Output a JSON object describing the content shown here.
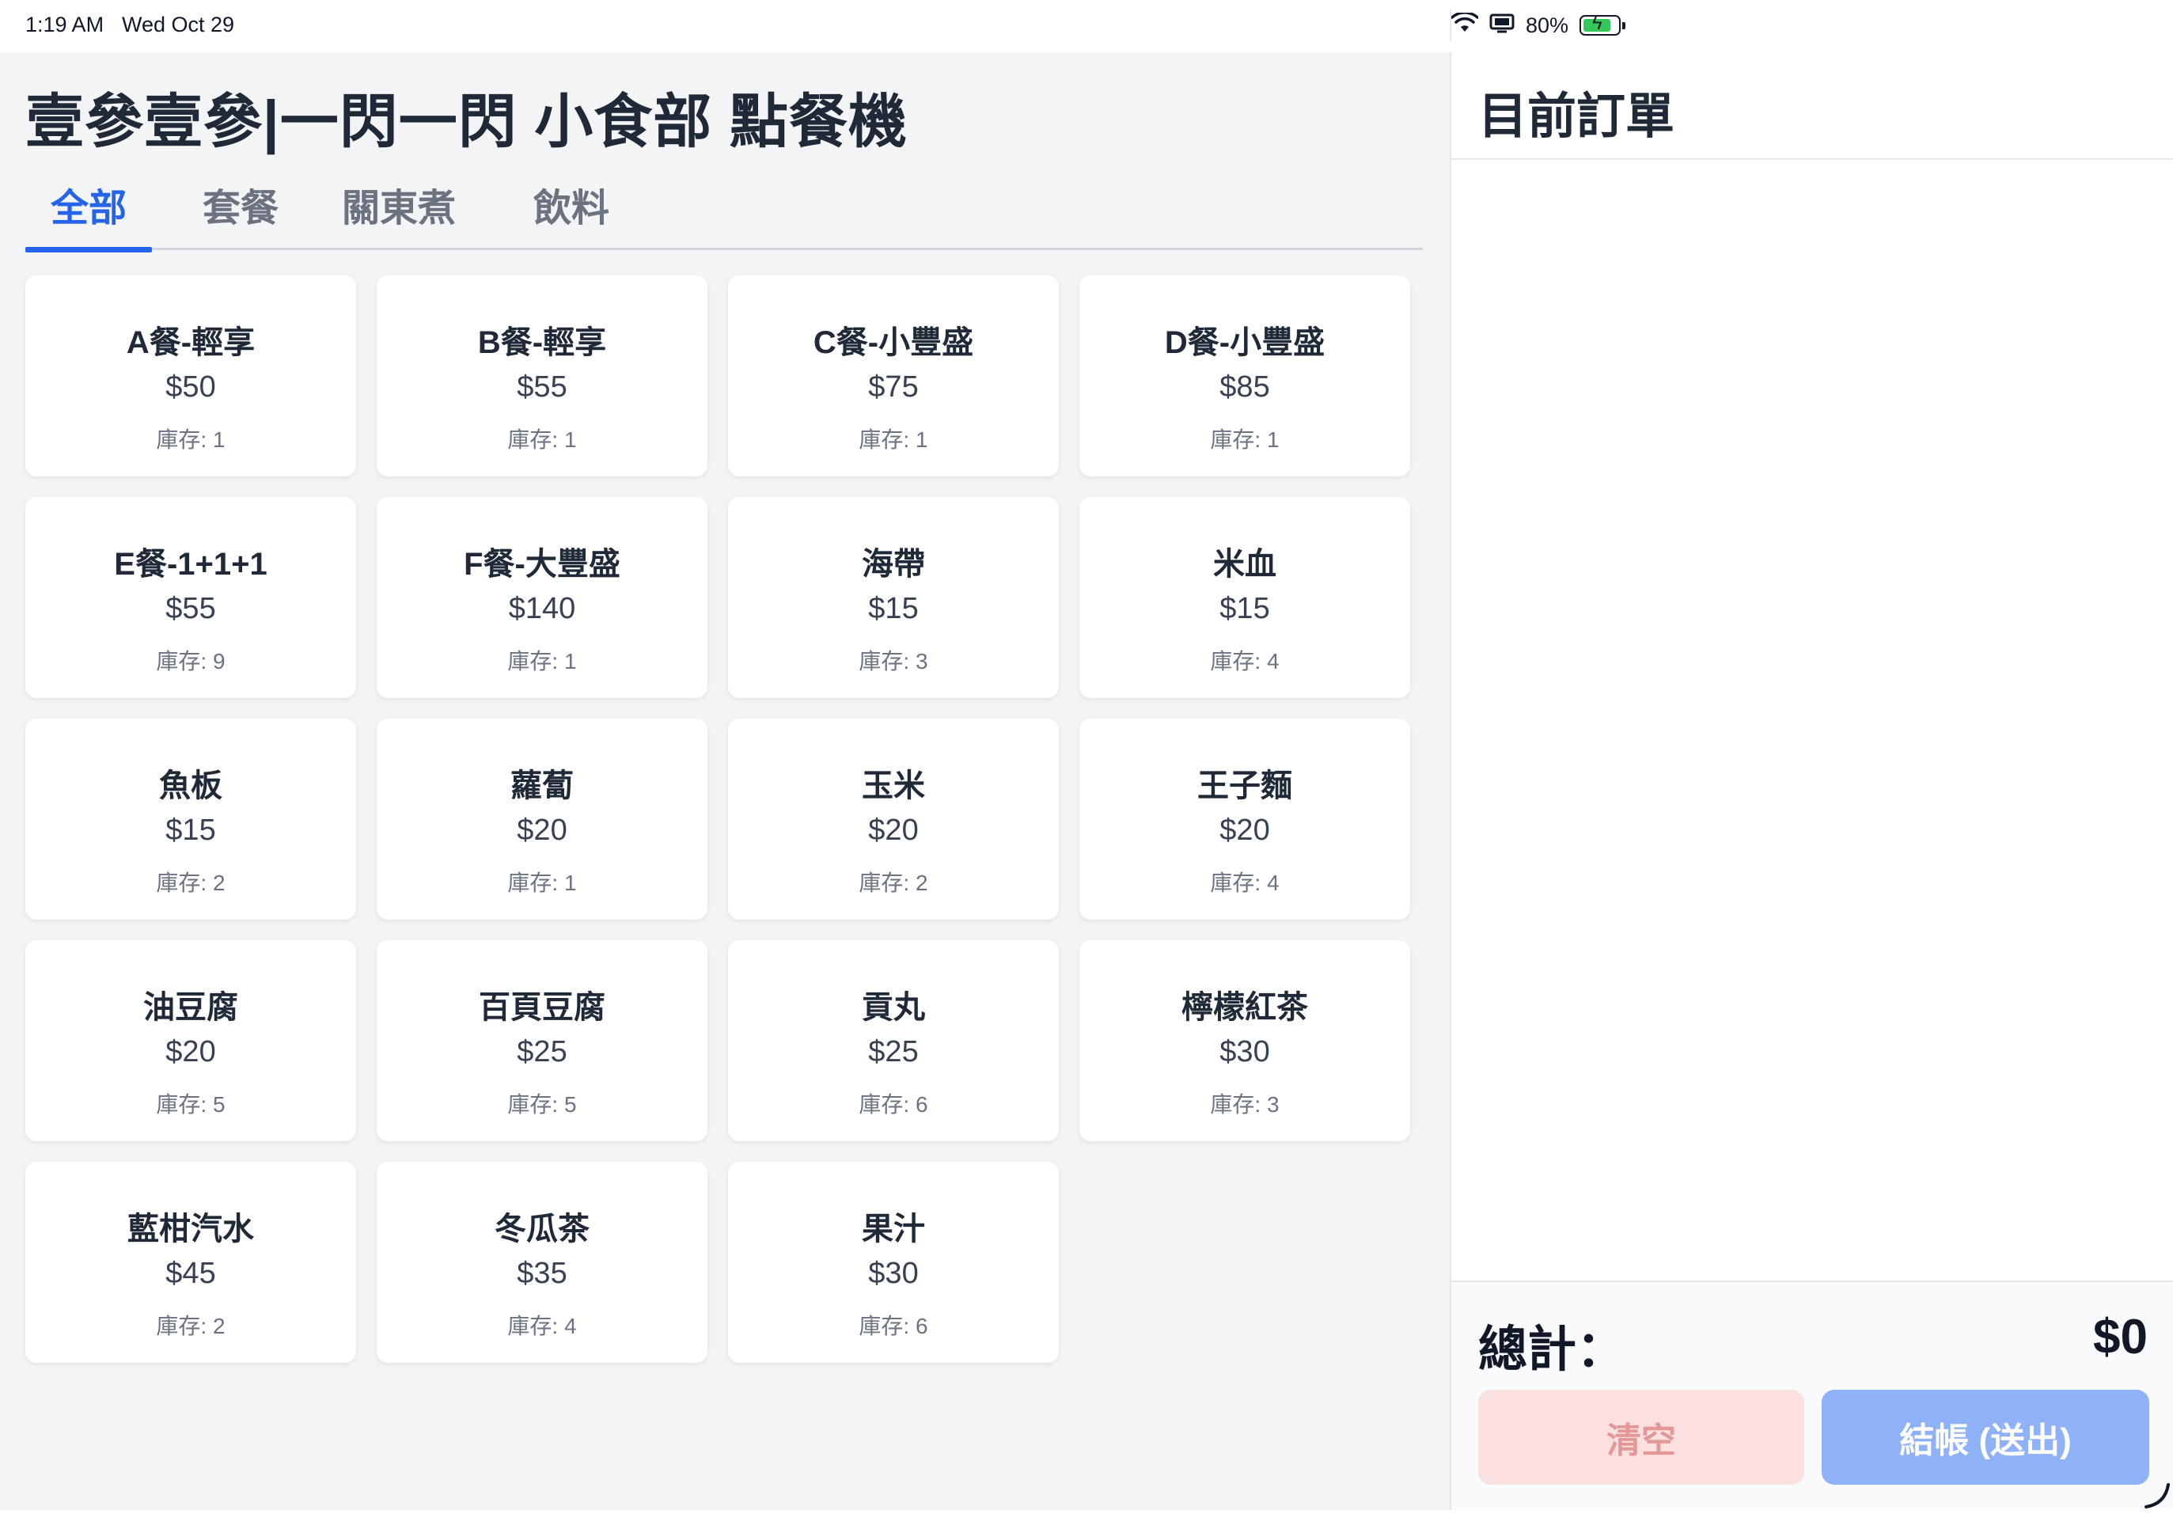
{
  "status_bar": {
    "time": "1:19 AM",
    "date": "Wed Oct 29",
    "battery_percent": "80%",
    "battery_level": 0.8,
    "icons": [
      "wifi-icon",
      "screen-mirroring-icon",
      "battery-charging-icon"
    ]
  },
  "app": {
    "title": "壹參壹參|一閃一閃 小食部 點餐機"
  },
  "tabs": [
    {
      "label": "全部",
      "active": true
    },
    {
      "label": "套餐",
      "active": false
    },
    {
      "label": "關東煮",
      "active": false
    },
    {
      "label": "飲料",
      "active": false
    }
  ],
  "stock_prefix": "庫存: ",
  "menu": [
    {
      "name": "A餐-輕享",
      "price": "$50",
      "stock": "庫存: 1"
    },
    {
      "name": "B餐-輕享",
      "price": "$55",
      "stock": "庫存: 1"
    },
    {
      "name": "C餐-小豐盛",
      "price": "$75",
      "stock": "庫存: 1"
    },
    {
      "name": "D餐-小豐盛",
      "price": "$85",
      "stock": "庫存: 1"
    },
    {
      "name": "E餐-1+1+1",
      "price": "$55",
      "stock": "庫存: 9"
    },
    {
      "name": "F餐-大豐盛",
      "price": "$140",
      "stock": "庫存: 1"
    },
    {
      "name": "海帶",
      "price": "$15",
      "stock": "庫存: 3"
    },
    {
      "name": "米血",
      "price": "$15",
      "stock": "庫存: 4"
    },
    {
      "name": "魚板",
      "price": "$15",
      "stock": "庫存: 2"
    },
    {
      "name": "蘿蔔",
      "price": "$20",
      "stock": "庫存: 1"
    },
    {
      "name": "玉米",
      "price": "$20",
      "stock": "庫存: 2"
    },
    {
      "name": "王子麵",
      "price": "$20",
      "stock": "庫存: 4"
    },
    {
      "name": "油豆腐",
      "price": "$20",
      "stock": "庫存: 5"
    },
    {
      "name": "百頁豆腐",
      "price": "$25",
      "stock": "庫存: 5"
    },
    {
      "name": "貢丸",
      "price": "$25",
      "stock": "庫存: 6"
    },
    {
      "name": "檸檬紅茶",
      "price": "$30",
      "stock": "庫存: 3"
    },
    {
      "name": "藍柑汽水",
      "price": "$45",
      "stock": "庫存: 2"
    },
    {
      "name": "冬瓜茶",
      "price": "$35",
      "stock": "庫存: 4"
    },
    {
      "name": "果汁",
      "price": "$30",
      "stock": "庫存: 6"
    }
  ],
  "order": {
    "title": "目前訂單",
    "items": [],
    "total_label": "總計：",
    "total_value": "$0",
    "clear_label": "清空",
    "checkout_label": "結帳 (送出)"
  },
  "colors": {
    "accent": "#2563eb",
    "background": "#f3f4f6",
    "clear_button": "#fbe0e0",
    "checkout_button": "#8fb1f7"
  }
}
